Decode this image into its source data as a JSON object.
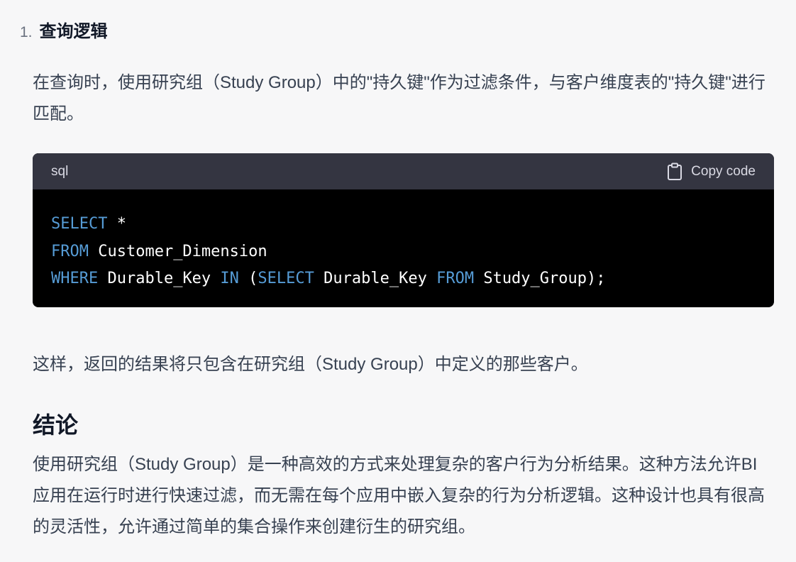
{
  "list_item": {
    "number": "1.",
    "title": "查询逻辑"
  },
  "paragraph_1": "在查询时，使用研究组（Study Group）中的\"持久键\"作为过滤条件，与客户维度表的\"持久键\"进行匹配。",
  "code_block": {
    "language": "sql",
    "copy_label": "Copy code",
    "copy_icon": "clipboard-icon",
    "lines": [
      [
        {
          "t": "SELECT",
          "kw": true
        },
        {
          "t": " *",
          "kw": false
        }
      ],
      [
        {
          "t": "FROM",
          "kw": true
        },
        {
          "t": " Customer_Dimension",
          "kw": false
        }
      ],
      [
        {
          "t": "WHERE",
          "kw": true
        },
        {
          "t": " Durable_Key ",
          "kw": false
        },
        {
          "t": "IN",
          "kw": true
        },
        {
          "t": " (",
          "kw": false
        },
        {
          "t": "SELECT",
          "kw": true
        },
        {
          "t": " Durable_Key ",
          "kw": false
        },
        {
          "t": "FROM",
          "kw": true
        },
        {
          "t": " Study_Group);",
          "kw": false
        }
      ]
    ],
    "keyword_color": "#569cd6",
    "text_color": "#ffffff",
    "header_bg": "#343541",
    "body_bg": "#000000"
  },
  "paragraph_2": "这样，返回的结果将只包含在研究组（Study Group）中定义的那些客户。",
  "section": {
    "title": "结论",
    "body": "使用研究组（Study Group）是一种高效的方式来处理复杂的客户行为分析结果。这种方法允许BI应用在运行时进行快速过滤，而无需在每个应用中嵌入复杂的行为分析逻辑。这种设计也具有很高的灵活性，允许通过简单的集合操作来创建衍生的研究组。"
  }
}
